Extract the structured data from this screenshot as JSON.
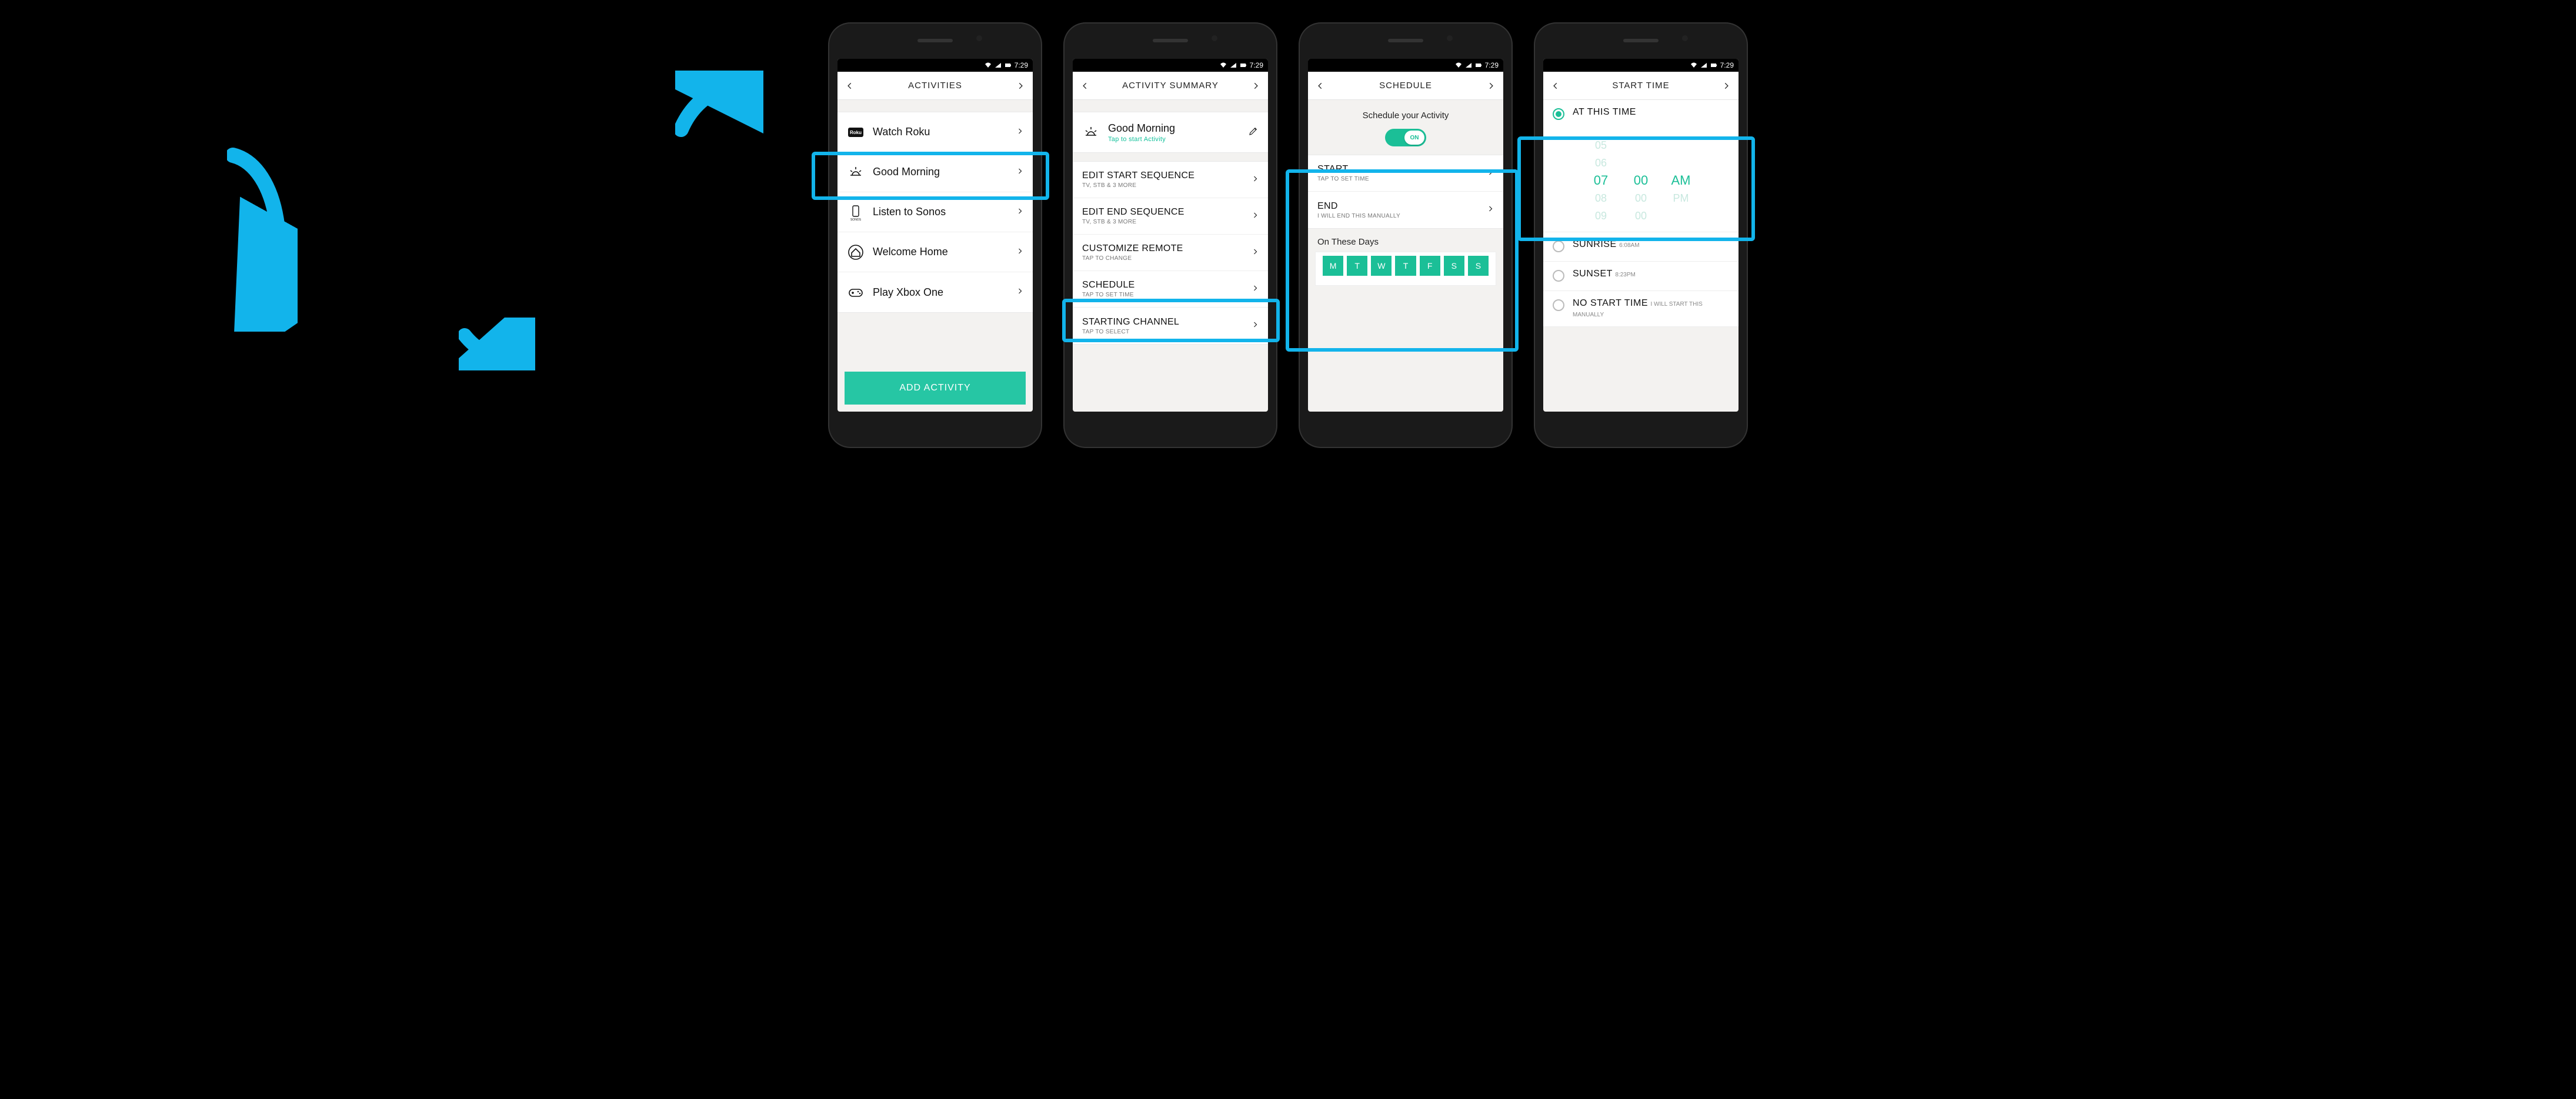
{
  "status_time": "7:29",
  "phones": {
    "activities": {
      "title": "ACTIVITIES",
      "items": [
        {
          "label": "Watch Roku"
        },
        {
          "label": "Good Morning"
        },
        {
          "label": "Listen to Sonos"
        },
        {
          "label": "Welcome Home"
        },
        {
          "label": "Play Xbox One"
        }
      ],
      "footer": "ADD ACTIVITY"
    },
    "summary": {
      "title": "ACTIVITY SUMMARY",
      "activity_name": "Good Morning",
      "activity_sub": "Tap to start Activity",
      "rows": [
        {
          "label": "EDIT START SEQUENCE",
          "sub": "TV, STB & 3 MORE"
        },
        {
          "label": "EDIT END SEQUENCE",
          "sub": "TV, STB & 3 MORE"
        },
        {
          "label": "CUSTOMIZE REMOTE",
          "sub": "TAP TO CHANGE"
        },
        {
          "label": "SCHEDULE",
          "sub": "TAP TO SET TIME"
        },
        {
          "label": "STARTING CHANNEL",
          "sub": "TAP TO SELECT"
        }
      ]
    },
    "schedule": {
      "title": "SCHEDULE",
      "prompt": "Schedule your Activity",
      "toggle": "ON",
      "start_label": "START",
      "start_sub": "TAP TO SET TIME",
      "end_label": "END",
      "end_sub": "I WILL END THIS MANUALLY",
      "days_label": "On These Days",
      "days": [
        "M",
        "T",
        "W",
        "T",
        "F",
        "S",
        "S"
      ]
    },
    "starttime": {
      "title": "START TIME",
      "at_this_time": "AT THIS TIME",
      "picker": {
        "hours_above2": "05",
        "hours_above1": "06",
        "hour": "07",
        "hours_below1": "08",
        "hours_below2": "09",
        "min": "00",
        "min_below": "00",
        "min_below2": "00",
        "ampm_sel": "AM",
        "ampm_other": "PM"
      },
      "sunrise_label": "SUNRISE",
      "sunrise_sub": "6:08AM",
      "sunset_label": "SUNSET",
      "sunset_sub": "8:23PM",
      "nostart_label": "NO START TIME",
      "nostart_sub": "I WILL START THIS MANUALLY"
    }
  }
}
